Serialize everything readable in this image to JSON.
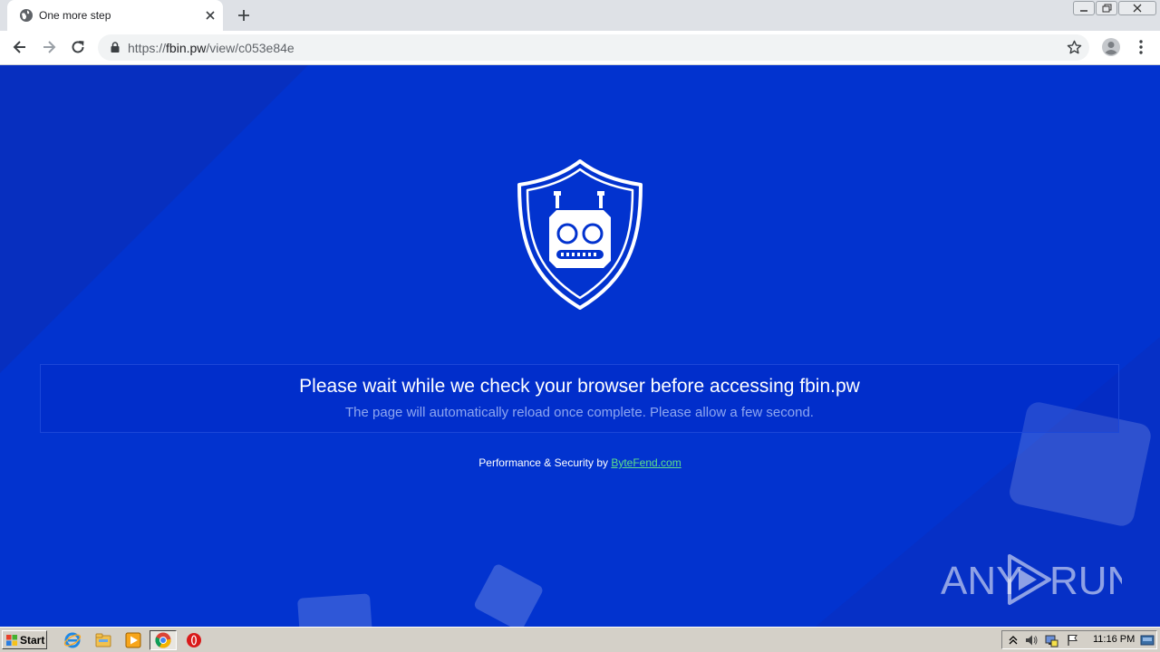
{
  "browser": {
    "tab": {
      "title": "One more step"
    },
    "address_bar": {
      "url_scheme": "https://",
      "url_host": "fbin.pw",
      "url_path": "/view/c053e84e"
    }
  },
  "page": {
    "heading": "Please wait while we check your browser before accessing fbin.pw",
    "subtext": "The page will automatically reload once complete. Please allow a few second.",
    "footer_prefix": "Performance & Security by ",
    "footer_link": "ByteFend.com",
    "colors": {
      "background": "#0233cf",
      "link": "#5fe08a",
      "subtext": "#8ea6f0"
    }
  },
  "watermark": {
    "text": "ANY RUN"
  },
  "taskbar": {
    "start_label": "Start",
    "clock": "11:16 PM",
    "apps": [
      "internet-explorer-icon",
      "file-explorer-icon",
      "media-player-icon",
      "chrome-icon",
      "opera-icon"
    ]
  }
}
